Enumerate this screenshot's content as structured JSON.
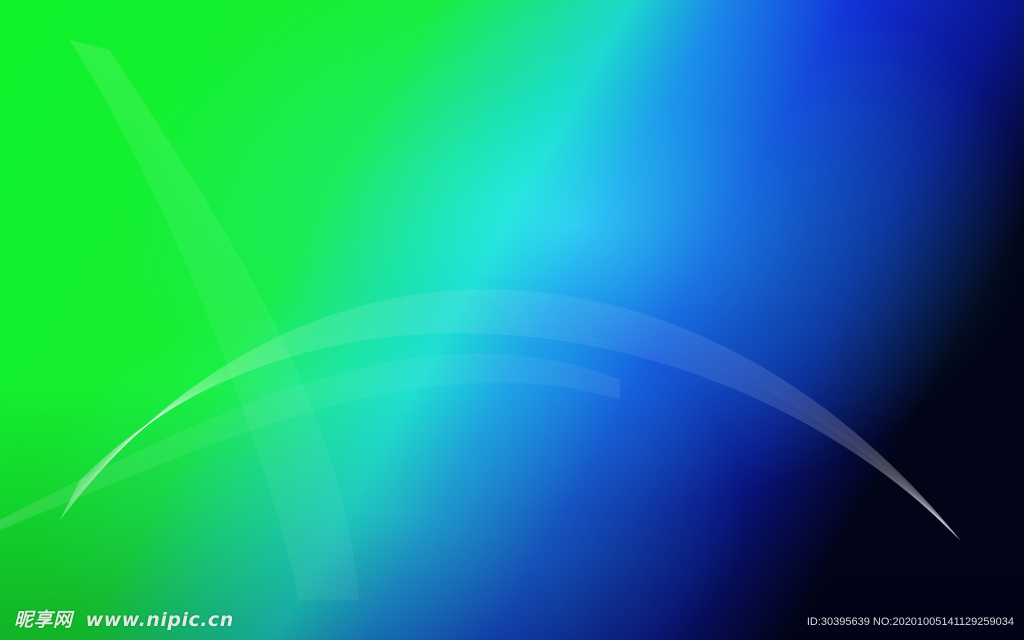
{
  "image": {
    "colors": {
      "green": "#0ef22c",
      "cyan": "#22e6e6",
      "blue": "#1230d8",
      "deep_blue": "#0a1690",
      "navy": "#020418"
    }
  },
  "watermark": {
    "logo_cn": "昵享网",
    "logo_url": "www.nipic.cn",
    "id_text": "ID:30395639 NO:20201005141129259034"
  }
}
